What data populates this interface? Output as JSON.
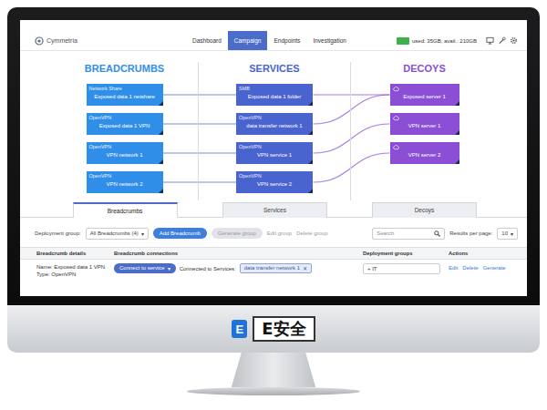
{
  "app": {
    "logo": "Cymmetria"
  },
  "nav": [
    {
      "label": "Dashboard",
      "selected": false
    },
    {
      "label": "Campaign",
      "selected": true
    },
    {
      "label": "Endpoints",
      "selected": false
    },
    {
      "label": "Investigation",
      "selected": false
    }
  ],
  "storage": {
    "text": "used: 35GB, avail.: 210GB"
  },
  "columns": [
    {
      "title": "BREADCRUMBS",
      "color": "#2f8fe8"
    },
    {
      "title": "SERVICES",
      "color": "#4a64cf"
    },
    {
      "title": "DECOYS",
      "color": "#8b4fd6"
    }
  ],
  "breadcrumbs": [
    {
      "type": "Network Share",
      "name": "Exposed data 1 netshare"
    },
    {
      "type": "OpenVPN",
      "name": "Exposed data 1 VPN"
    },
    {
      "type": "OpenVPN",
      "name": "VPN network 1"
    },
    {
      "type": "OpenVPN",
      "name": "VPN network 2"
    }
  ],
  "services": [
    {
      "type": "SMB",
      "name": "Exposed data 1 folder"
    },
    {
      "type": "OpenVPN",
      "name": "data transfer network 1"
    },
    {
      "type": "OpenVPN",
      "name": "VPN service 1"
    },
    {
      "type": "OpenVPN",
      "name": "VPN service 2"
    }
  ],
  "decoys": [
    {
      "name": "Exposed server 1"
    },
    {
      "name": "VPN server 1"
    },
    {
      "name": "VPN server 2"
    }
  ],
  "links": {
    "breadcrumb_service": [
      [
        0,
        0
      ],
      [
        1,
        1
      ],
      [
        2,
        2
      ],
      [
        3,
        3
      ]
    ],
    "service_decoy": [
      [
        0,
        0
      ],
      [
        1,
        0
      ],
      [
        2,
        1
      ],
      [
        3,
        2
      ]
    ]
  },
  "tabs": [
    {
      "label": "Breadcrumbs",
      "selected": true
    },
    {
      "label": "Services",
      "selected": false
    },
    {
      "label": "Decoys",
      "selected": false
    }
  ],
  "toolbar": {
    "group_label": "Deployment group:",
    "group_value": "All Breadcrumbs (4)",
    "caret": "▾",
    "add_button": "Add Breadcrumb",
    "group_actions": [
      {
        "label": "Generate group",
        "disabled": true,
        "kind": "button"
      },
      {
        "label": "Edit group",
        "disabled": true,
        "kind": "link"
      },
      {
        "label": "Delete group",
        "disabled": true,
        "kind": "link"
      }
    ],
    "search_placeholder": "Search",
    "results_label": "Results per page:",
    "results_value": "10"
  },
  "table": {
    "columns": [
      "Breadcrumb details",
      "Breadcrumb connections",
      "Deployment groups",
      "Actions"
    ],
    "rows": [
      {
        "name": "Name: Exposed data 1 VPN",
        "type": "Type: OpenVPN",
        "connect_button": "Connect to service",
        "connected_label": "Connected to Services:",
        "services": [
          {
            "label": "data transfer network 1",
            "remove": "✕"
          }
        ],
        "groups": "+ IT",
        "actions": [
          "Edit",
          "Delete",
          "Generate"
        ]
      }
    ]
  },
  "watermark": {
    "letter": "E",
    "text": "E安全"
  }
}
